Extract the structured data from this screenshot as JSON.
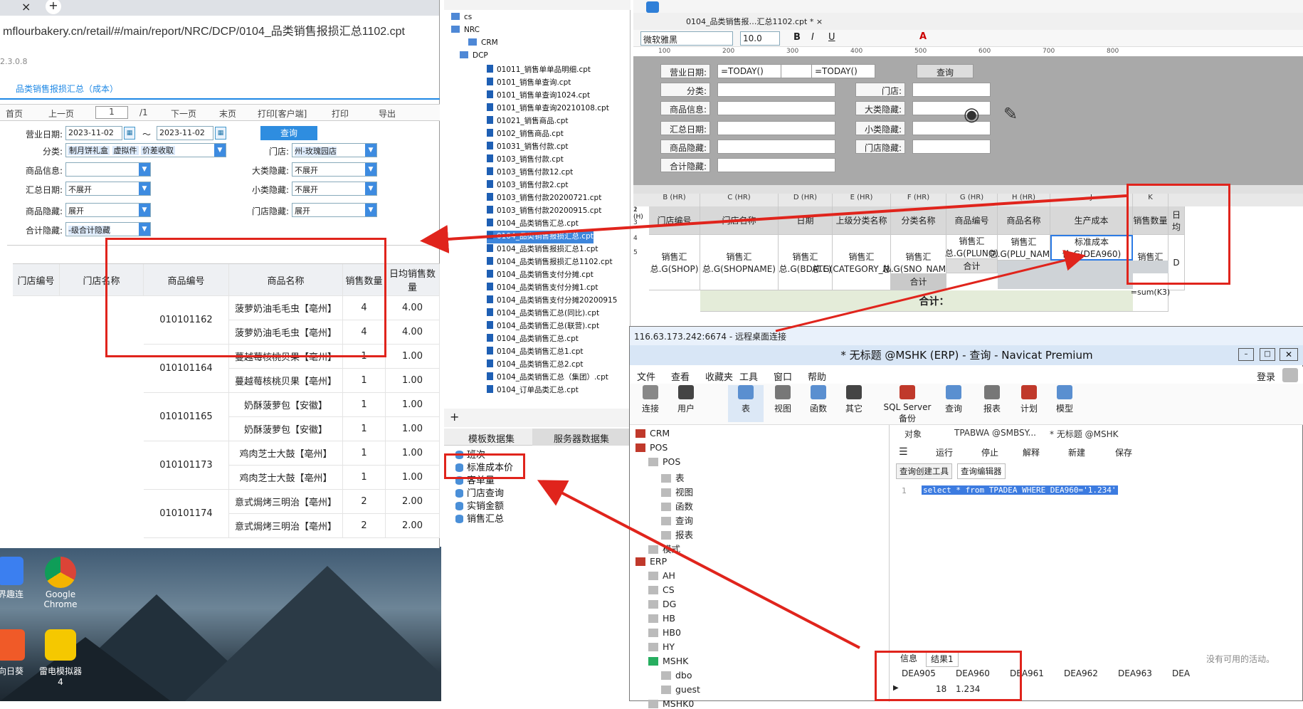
{
  "browser": {
    "tab_close": "×",
    "tab_new": "+",
    "url": "mflourbakery.cn/retail/#/main/report/NRC/DCP/0104_品类销售报损汇总1102.cpt",
    "version": "2.3.0.8",
    "report_tab": "品类销售报损汇总（成本）",
    "pager": {
      "first": "首页",
      "prev": "上一页",
      "page": "1",
      "total": "/1",
      "next": "下一页",
      "last": "末页",
      "print_client": "打印[客户端]",
      "print": "打印",
      "export": "导出"
    },
    "filters": {
      "biz_date_label": "营业日期:",
      "date_from": "2023-11-02",
      "tilde": "～",
      "date_to": "2023-11-02",
      "query": "查询",
      "category_label": "分类:",
      "category_chips": [
        "制月饼礼盒",
        "虚拟件",
        "价差收取"
      ],
      "store_label": "门店:",
      "store_value": "州-玫瑰园店",
      "goods_info_label": "商品信息:",
      "big_hide_label": "大类隐藏:",
      "big_hide_value": "不展开",
      "sum_date_label": "汇总日期:",
      "sum_date_value": "不展开",
      "small_hide_label": "小类隐藏:",
      "small_hide_value": "不展开",
      "goods_hide_label": "商品隐藏:",
      "goods_hide_value": "展开",
      "store_hide_label": "门店隐藏:",
      "store_hide_value": "展开",
      "total_hide_label": "合计隐藏:",
      "total_hide_value": "-级合计隐藏"
    },
    "table": {
      "headers": [
        "门店编号",
        "门店名称",
        "商品编号",
        "商品名称",
        "销售数量",
        "日均销售数量"
      ],
      "groups": [
        {
          "code": "010101162",
          "rows": [
            [
              "菠萝奶油毛毛虫【亳州】",
              "4",
              "4.00"
            ],
            [
              "菠萝奶油毛毛虫【亳州】",
              "4",
              "4.00"
            ]
          ]
        },
        {
          "code": "010101164",
          "rows": [
            [
              "蔓越莓核桃贝果【亳州】",
              "1",
              "1.00"
            ],
            [
              "蔓越莓核桃贝果【亳州】",
              "1",
              "1.00"
            ]
          ]
        },
        {
          "code": "010101165",
          "rows": [
            [
              "奶酥菠萝包【安徽】",
              "1",
              "1.00"
            ],
            [
              "奶酥菠萝包【安徽】",
              "1",
              "1.00"
            ]
          ]
        },
        {
          "code": "010101173",
          "rows": [
            [
              "鸡肉芝士大鼓【亳州】",
              "1",
              "1.00"
            ],
            [
              "鸡肉芝士大鼓【亳州】",
              "1",
              "1.00"
            ]
          ]
        },
        {
          "code": "010101174",
          "rows": [
            [
              "意式焗烤三明治【亳州】",
              "2",
              "2.00"
            ],
            [
              "意式焗烤三明治【亳州】",
              "2",
              "2.00"
            ]
          ]
        }
      ]
    }
  },
  "desktop": {
    "icons": [
      "界趣连",
      "Google Chrome",
      "向日葵",
      "雷电模拟器4"
    ]
  },
  "tree": {
    "top": [
      "cs",
      "NRC",
      "CRM",
      "DCP"
    ],
    "files": [
      "01011_销售单单品明细.cpt",
      "0101_销售单查询.cpt",
      "0101_销售单查询1024.cpt",
      "0101_销售单查询20210108.cpt",
      "01021_销售商品.cpt",
      "0102_销售商品.cpt",
      "01031_销售付款.cpt",
      "0103_销售付款.cpt",
      "0103_销售付款12.cpt",
      "0103_销售付款2.cpt",
      "0103_销售付款20200721.cpt",
      "0103_销售付款20200915.cpt",
      "0104_品类销售汇总.cpt",
      "0104_品类销售报损汇总.cpt",
      "0104_品类销售报损汇总1.cpt",
      "0104_品类销售报损汇总1102.cpt",
      "0104_品类销售支付分摊.cpt",
      "0104_品类销售支付分摊1.cpt",
      "0104_品类销售支付分摊20200915",
      "0104_品类销售汇总(同比).cpt",
      "0104_品类销售汇总(联营).cpt",
      "0104_品类销售汇总.cpt",
      "0104_品类销售汇总1.cpt",
      "0104_品类销售汇总2.cpt",
      "0104_品类销售汇总（集团）.cpt",
      "0104_订单品类汇总.cpt"
    ],
    "dataset_tabs": [
      "模板数据集",
      "服务器数据集"
    ],
    "datasets": [
      "班次",
      "标准成本价",
      "客单量",
      "门店查询",
      "实销金额",
      "销售汇总"
    ]
  },
  "designer": {
    "tab": "0104_品类销售报…汇总1102.cpt *",
    "font": "微软雅黑",
    "size": "10.0",
    "ruler": [
      "100",
      "200",
      "300",
      "400",
      "500",
      "600",
      "700",
      "800"
    ],
    "params": {
      "biz_date": "营业日期:",
      "today1": "=TODAY()",
      "today2": "=TODAY()",
      "query": "查询",
      "category": "分类:",
      "store": "门店:",
      "goods_info": "商品信息:",
      "big_hide": "大类隐藏:",
      "sum_date": "汇总日期:",
      "small_hide": "小类隐藏:",
      "goods_hide": "商品隐藏:",
      "store_hide": "门店隐藏:",
      "total_hide": "合计隐藏:"
    },
    "cols": [
      "B (HR)",
      "C (HR)",
      "D (HR)",
      "E (HR)",
      "F (HR)",
      "G (HR)",
      "H (HR)",
      "J",
      "K"
    ],
    "row_nums": [
      "1 (H)",
      "2 (H)",
      "3",
      "4",
      "5"
    ],
    "header_cells": [
      "门店编号",
      "门店名称",
      "日期",
      "上级分类名称",
      "分类名称",
      "商品编号",
      "商品名称",
      "生产成本",
      "销售数量",
      "日均"
    ],
    "data_cells": [
      "销售汇总.G(SHOP)",
      "销售汇总.G(SHOPNAME)",
      "销售汇总.G(BDATE)",
      "销售汇总.G(CATEGORY_NAME)",
      "销售汇总.G(SNO_NAME)",
      "销售汇总.G(PLUNO)",
      "销售汇总.G(PLU_NAME)",
      "标准成本价.G(DEA960)",
      "销售汇总.求和(",
      "D"
    ],
    "subtotal": "合计",
    "total": "合计：",
    "k_formula": "=sum(K3)"
  },
  "navicat": {
    "rd_title": "116.63.173.242:6674 - 远程桌面连接",
    "title": "* 无标题 @MSHK (ERP) - 查询 - Navicat Premium",
    "menu": [
      "文件",
      "查看",
      "收藏夹",
      "工具",
      "窗口",
      "帮助"
    ],
    "login": "登录",
    "toolbar": [
      "连接",
      "用户",
      "表",
      "视图",
      "函数",
      "其它",
      "SQL Server 备份",
      "查询",
      "报表",
      "计划",
      "模型"
    ],
    "tree": [
      {
        "t": "CRM",
        "lvl": 0
      },
      {
        "t": "POS",
        "lvl": 0
      },
      {
        "t": "POS",
        "lvl": 1
      },
      {
        "t": "表",
        "lvl": 2
      },
      {
        "t": "视图",
        "lvl": 2
      },
      {
        "t": "函数",
        "lvl": 2
      },
      {
        "t": "查询",
        "lvl": 2
      },
      {
        "t": "报表",
        "lvl": 2
      },
      {
        "t": "模式",
        "lvl": 1
      },
      {
        "t": "ERP",
        "lvl": 0
      },
      {
        "t": "AH",
        "lvl": 1
      },
      {
        "t": "CS",
        "lvl": 1
      },
      {
        "t": "DG",
        "lvl": 1
      },
      {
        "t": "HB",
        "lvl": 1
      },
      {
        "t": "HB0",
        "lvl": 1
      },
      {
        "t": "HY",
        "lvl": 1
      },
      {
        "t": "MSHK",
        "lvl": 1
      },
      {
        "t": "dbo",
        "lvl": 2
      },
      {
        "t": "guest",
        "lvl": 2
      },
      {
        "t": "MSHK0",
        "lvl": 1
      }
    ],
    "obj_tabs": [
      "对象",
      "TPABWA @SMBSY...",
      "* 无标题 @MSHK"
    ],
    "qtool": [
      "运行",
      "停止",
      "解释",
      "新建",
      "保存"
    ],
    "subtabs": [
      "查询创建工具",
      "查询编辑器"
    ],
    "line_no": "1",
    "sql": "select * from TPADEA WHERE DEA960='1.234'",
    "result_tabs": [
      "信息",
      "结果1"
    ],
    "result_cols": [
      "DEA905",
      "DEA960",
      "DEA961",
      "DEA962",
      "DEA963",
      "DEA"
    ],
    "result_row": [
      "18",
      "1.234"
    ],
    "no_activity": "没有可用的活动。"
  }
}
